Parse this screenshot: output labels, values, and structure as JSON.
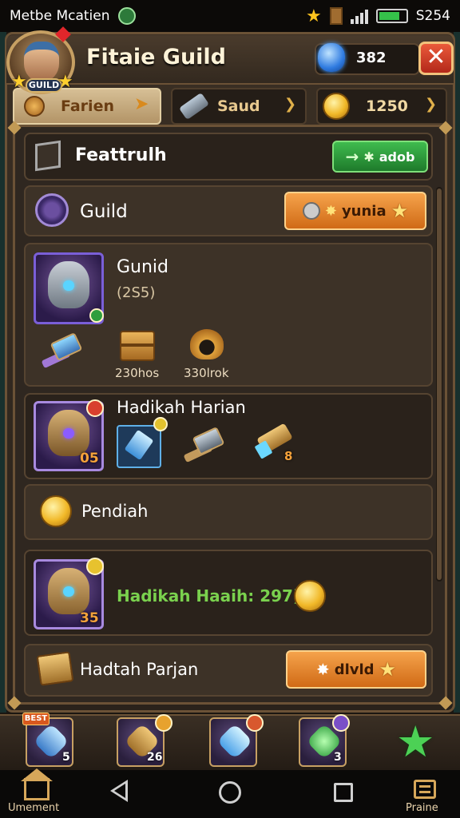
{
  "status_bar": {
    "carrier": "Metbe Mcatien",
    "clock": "S254"
  },
  "header": {
    "avatar_tag": "GUILD",
    "title": "Fitaie Guild",
    "gems": "382",
    "close_symbol": "✕"
  },
  "tabs": [
    {
      "label": "Farien",
      "active": true
    },
    {
      "label": "Saud",
      "active": false
    },
    {
      "label": "1250",
      "active": false
    }
  ],
  "feature_row": {
    "label": "Feattrulh",
    "button_label": "adob",
    "button_arrow": "→"
  },
  "guild_row": {
    "label": "Guild",
    "button_label": "yunia"
  },
  "guild_card": {
    "name": "Gunid",
    "sub": "(2S5)",
    "items": [
      {
        "icon": "hammer-icon",
        "caption": ""
      },
      {
        "icon": "chest-icon",
        "caption": "230hos"
      },
      {
        "icon": "horn-icon",
        "caption": "330lrok"
      }
    ]
  },
  "daily_reward": {
    "title": "Hadikah Harian",
    "badge": "05",
    "items": [
      {
        "icon": "crystal-sword-icon",
        "count": ""
      },
      {
        "icon": "hammer-icon",
        "count": ""
      },
      {
        "icon": "scroll-icon",
        "count": "8"
      }
    ]
  },
  "reward_section": {
    "label": "Pendiah"
  },
  "reward_daily_row": {
    "text": "Hadikah Haaih: 297)",
    "badge": "35"
  },
  "pending_row": {
    "label": "Hadtah Parjan",
    "button_label": "dlvld"
  },
  "item_bar": [
    {
      "tag": "BEST",
      "num": "5",
      "color": "#5fb0e8"
    },
    {
      "tag": "",
      "num": "26",
      "color": "#d8a046"
    },
    {
      "tag": "",
      "num": "",
      "color": "#6fd8ff"
    },
    {
      "tag": "",
      "num": "3",
      "color": "#3fd15a"
    }
  ],
  "nav": {
    "left_label": "Umement",
    "right_label": "Praine"
  },
  "colors": {
    "accent_orange": "#e8892e",
    "accent_green": "#2f9e3d",
    "gem_blue": "#2f7be0",
    "frame_brown": "#6b5236"
  }
}
